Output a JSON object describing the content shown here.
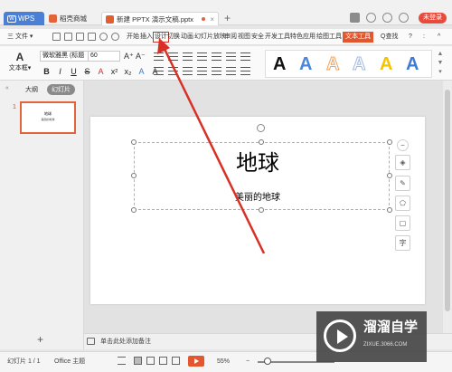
{
  "titlebar": {
    "wps_tab": "WPS",
    "store_tab": "稻壳商城",
    "doc_tab": "新建 PPTX 演示文稿.pptx",
    "new_tab": "+",
    "login": "未登录"
  },
  "menubar": {
    "file": "三 文件 ▾",
    "items": [
      "开始",
      "插入",
      "设计",
      "切换",
      "动画",
      "幻灯片放映",
      "审阅",
      "视图",
      "安全",
      "开发工具",
      "特色应用",
      "绘图工具",
      "文本工具"
    ],
    "search": "Q查找",
    "help": "?",
    "more": ":",
    "collapse": "^"
  },
  "ribbon": {
    "textbox_label": "文本框▾",
    "font_name": "微软雅黑 (标题",
    "font_size": "60",
    "grow": "A⁺",
    "shrink": "A⁻",
    "clear": "◇",
    "format": [
      "B",
      "I",
      "U",
      "S",
      "A",
      "x²",
      "x₂",
      "A",
      "A"
    ],
    "styles": [
      {
        "glyph": "A",
        "color": "#111111"
      },
      {
        "glyph": "A",
        "color": "#4a87d8"
      },
      {
        "glyph": "A",
        "color": "#f0a15c"
      },
      {
        "glyph": "A",
        "color": "#9fb8e6"
      },
      {
        "glyph": "A",
        "color": "#f6c200"
      },
      {
        "glyph": "A",
        "color": "#3f7bd4"
      }
    ]
  },
  "left_panel": {
    "collapse": "«",
    "outline_tab": "大纲",
    "slides_tab": "幻灯片",
    "slide_number": "1",
    "thumb_title": "地球",
    "thumb_subtitle": "美丽的地球",
    "add": "+"
  },
  "slide": {
    "title": "地球",
    "subtitle": "美丽的地球"
  },
  "float_toolbar": [
    "−",
    "◈",
    "✎",
    "⬠",
    "▢",
    "字"
  ],
  "notes": {
    "placeholder": "单击此处添加备注"
  },
  "status": {
    "slide_info": "幻灯片 1 / 1",
    "theme": "Office 主题",
    "zoom": "55%",
    "zoom_minus": "−",
    "zoom_plus": "+"
  },
  "watermark": {
    "brand": "溜溜自学",
    "url": "ZIXUE.3066.COM"
  },
  "colors": {
    "accent": "#e4572e",
    "annotation": "#d93025",
    "wps_blue": "#4a7fd6"
  }
}
